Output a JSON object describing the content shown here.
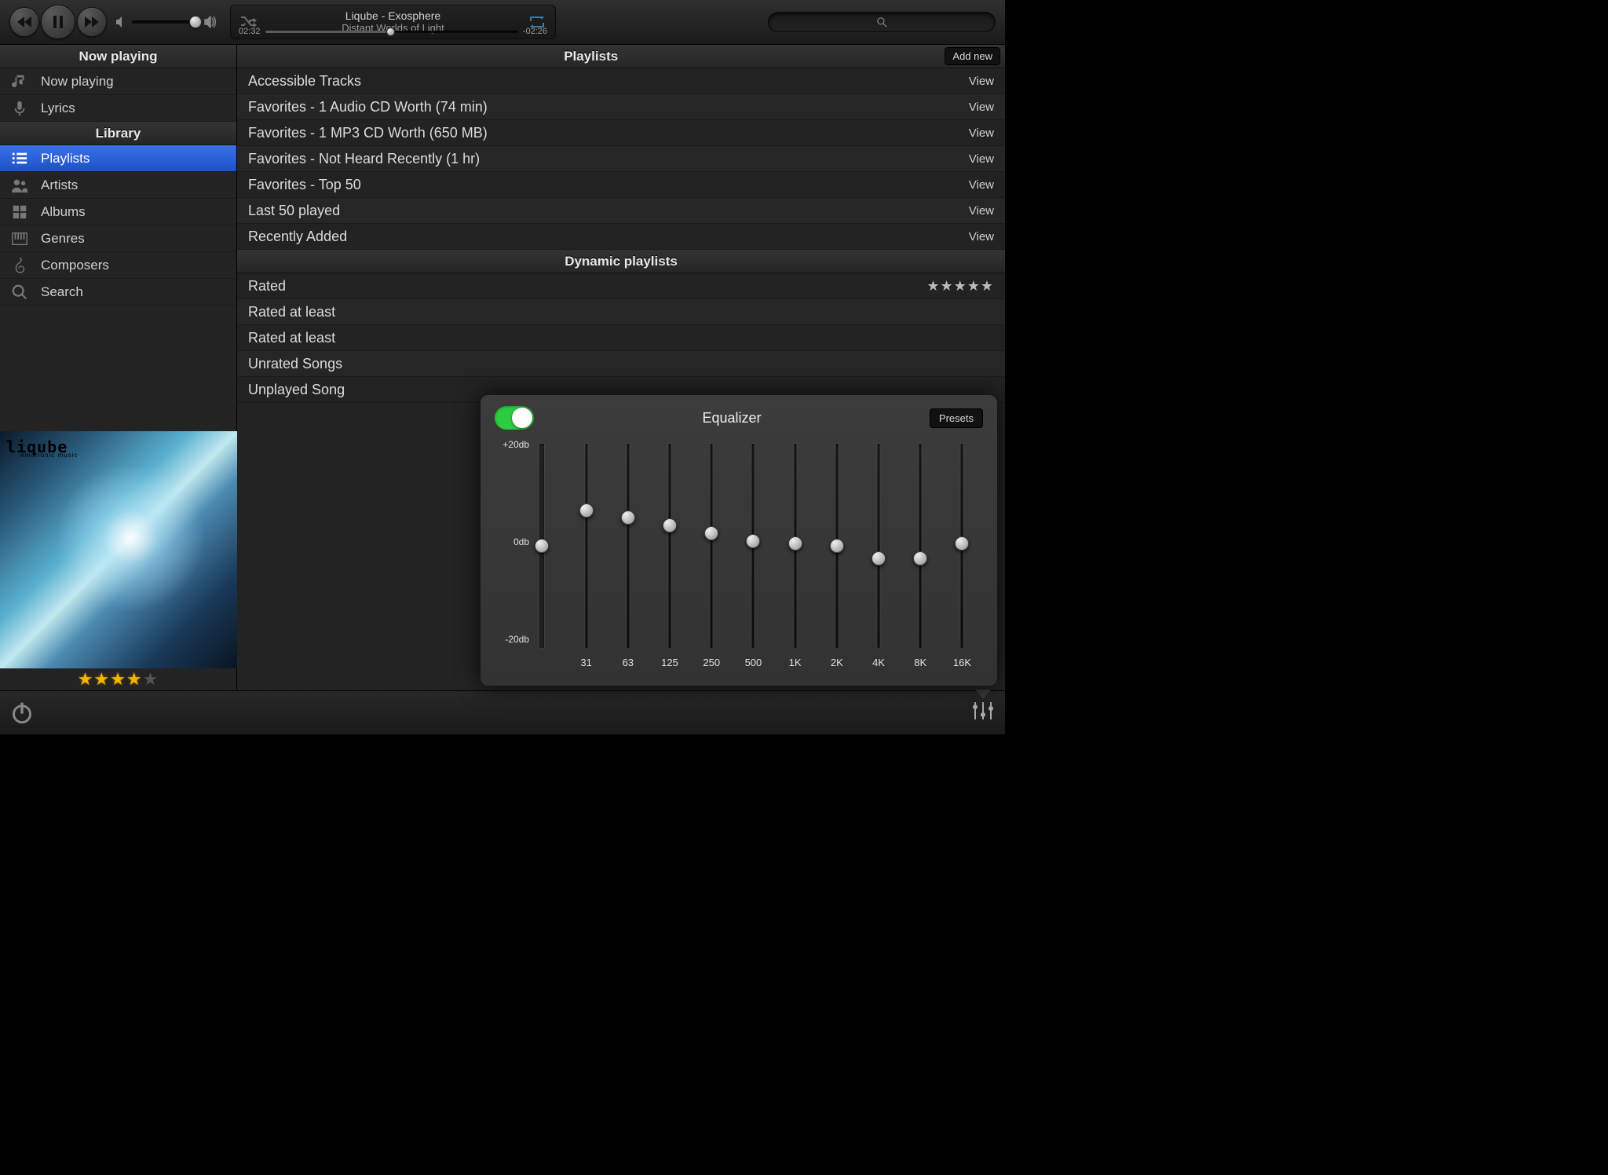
{
  "player": {
    "track_line": "Liqube - Exosphere",
    "album_line": "Distant Worlds of Light",
    "elapsed": "02:32",
    "remaining": "-02:26",
    "progress_pct": 48,
    "volume_pct": 95
  },
  "sidebar": {
    "section_now": "Now playing",
    "section_lib": "Library",
    "items_now": [
      {
        "label": "Now playing",
        "icon": "music-note"
      },
      {
        "label": "Lyrics",
        "icon": "mic"
      }
    ],
    "items_lib": [
      {
        "label": "Playlists",
        "icon": "list",
        "active": true
      },
      {
        "label": "Artists",
        "icon": "people"
      },
      {
        "label": "Albums",
        "icon": "grid"
      },
      {
        "label": "Genres",
        "icon": "piano"
      },
      {
        "label": "Composers",
        "icon": "treble"
      },
      {
        "label": "Search",
        "icon": "search"
      }
    ],
    "art_title": "liqube",
    "art_sub": "electronic music",
    "rating": 4
  },
  "main": {
    "playlists_header": "Playlists",
    "add_new": "Add new",
    "view_label": "View",
    "playlists": [
      "Accessible Tracks",
      "Favorites - 1 Audio CD Worth (74 min)",
      "Favorites - 1 MP3 CD Worth (650 MB)",
      "Favorites - Not Heard Recently (1 hr)",
      "Favorites - Top 50",
      "Last 50 played",
      "Recently Added"
    ],
    "dynamic_header": "Dynamic playlists",
    "dynamic": [
      {
        "name": "Rated",
        "trailing": "stars"
      },
      {
        "name": "Rated at least"
      },
      {
        "name": "Rated at least"
      },
      {
        "name": "Unrated Songs"
      },
      {
        "name": "Unplayed Song"
      }
    ]
  },
  "equalizer": {
    "title": "Equalizer",
    "presets": "Presets",
    "on": true,
    "scale_top": "+20db",
    "scale_mid": "0db",
    "scale_bot": "-20db",
    "master": 0,
    "bands": [
      {
        "hz": "31",
        "db": 7
      },
      {
        "hz": "63",
        "db": 5.5
      },
      {
        "hz": "125",
        "db": 4
      },
      {
        "hz": "250",
        "db": 2.5
      },
      {
        "hz": "500",
        "db": 1
      },
      {
        "hz": "1K",
        "db": 0.5
      },
      {
        "hz": "2K",
        "db": 0
      },
      {
        "hz": "4K",
        "db": -2.5
      },
      {
        "hz": "8K",
        "db": -2.5
      },
      {
        "hz": "16K",
        "db": 0.5
      }
    ]
  },
  "colors": {
    "accent": "#2962d8",
    "toggle_on": "#2ecc40",
    "star_on": "#f5b400"
  }
}
